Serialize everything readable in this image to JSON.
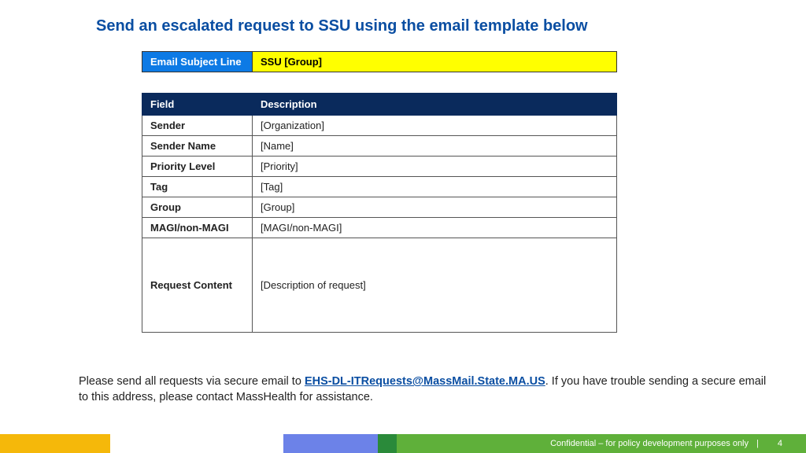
{
  "title": "Send an escalated request to SSU using the email template below",
  "subject": {
    "label": "Email Subject Line",
    "value": "SSU [Group]"
  },
  "fields": {
    "header_field": "Field",
    "header_desc": "Description",
    "rows": [
      {
        "field": "Sender",
        "desc": "[Organization]"
      },
      {
        "field": "Sender Name",
        "desc": "[Name]"
      },
      {
        "field": "Priority Level",
        "desc": "[Priority]"
      },
      {
        "field": "Tag",
        "desc": "[Tag]"
      },
      {
        "field": "Group",
        "desc": "[Group]"
      },
      {
        "field": "MAGI/non-MAGI",
        "desc": "[MAGI/non-MAGI]"
      },
      {
        "field": "Request Content",
        "desc": "[Description of request]"
      }
    ]
  },
  "footnote": {
    "pre": "Please send all requests via secure email to ",
    "link": "EHS-DL-ITRequests@MassMail.State.MA.US",
    "post": ". If you have trouble sending a secure email to this address, please contact MassHealth for assistance."
  },
  "footer": {
    "conf": "Confidential – for policy development purposes only",
    "sep": "|",
    "page": "4"
  }
}
